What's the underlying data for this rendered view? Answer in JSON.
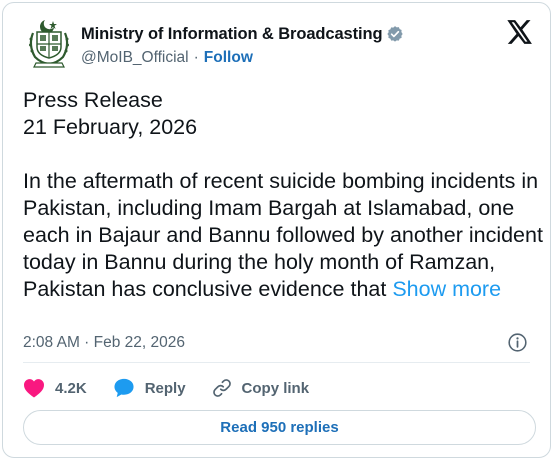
{
  "account": {
    "display_name": "Ministry of Information & Broadcasting",
    "handle": "@MoIB_Official",
    "separator": "·",
    "follow_label": "Follow",
    "verified_badge": "verified-gray-badge",
    "avatar": "pakistan-state-emblem"
  },
  "post": {
    "line1": "Press Release",
    "line2": "21 February, 2026",
    "paragraph": "In the aftermath of recent suicide bombing incidents in Pakistan, including Imam Bargah at Islamabad, one each in Bajaur and Bannu followed by another incident today in Bannu during the holy month of Ramzan, Pakistan has conclusive evidence that",
    "show_more": "Show more",
    "timestamp": "2:08 AM · Feb 22, 2026"
  },
  "actions": {
    "like_count": "4.2K",
    "reply_label": "Reply",
    "copy_link_label": "Copy link",
    "read_replies_label": "Read 950 replies"
  },
  "colors": {
    "like": "#f91880",
    "reply": "#1d9bf0",
    "link": "#1d9bf0",
    "follow": "#1d6fb8",
    "muted": "#536471",
    "border": "#cfd9de"
  },
  "icons": {
    "logo": "x-logo-icon",
    "info": "info-icon",
    "like": "heart-icon",
    "reply": "chat-bubble-icon",
    "copy_link": "link-icon"
  }
}
